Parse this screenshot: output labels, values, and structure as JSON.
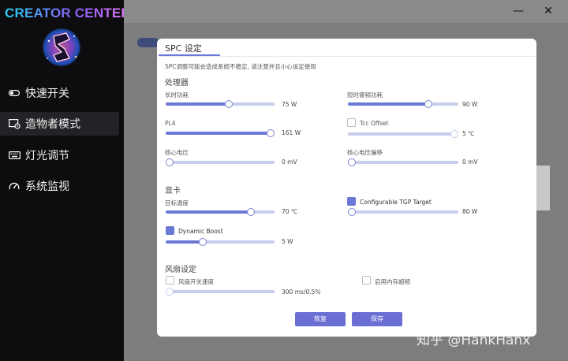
{
  "sidebar": {
    "app_title": "CREATOR CENTER",
    "items": [
      {
        "label": "快速开关",
        "icon": "toggle-icon",
        "active": false
      },
      {
        "label": "造物者模式",
        "icon": "creator-mode-icon",
        "active": true
      },
      {
        "label": "灯光调节",
        "icon": "keyboard-icon",
        "active": false
      },
      {
        "label": "系统监视",
        "icon": "gauge-icon",
        "active": false
      }
    ]
  },
  "window_controls": {
    "minimize": "—",
    "close": "✕"
  },
  "modal": {
    "tab_title": "SPC 设定",
    "warning": "SPC调整可能会造成系统不稳定, 请注意并且小心设定使用",
    "processor": {
      "section_title": "处理器",
      "long_power": {
        "label": "长时功耗",
        "value": "75 W",
        "fraction": 0.58
      },
      "short_power": {
        "label": "短时睿频功耗",
        "value": "90 W",
        "fraction": 0.73
      },
      "pl4": {
        "label": "PL4",
        "value": "161 W",
        "fraction": 0.97
      },
      "tcc_offset": {
        "label": "Tcc Offset",
        "value": "5 ℃",
        "checked": false,
        "fraction": 0.98
      },
      "core_voltage": {
        "label": "核心电压",
        "value": "0 mV",
        "fraction": 0.0
      },
      "core_voltage_offset": {
        "label": "核心电压偏移",
        "value": "0 mV",
        "fraction": 0.0
      }
    },
    "gpu": {
      "section_title": "显卡",
      "target_temp": {
        "label": "目标温度",
        "value": "70 ℃",
        "fraction": 0.78
      },
      "configurable_tgp": {
        "label": "Configurable TGP Target",
        "value": "80 W",
        "checked": true,
        "fraction": 0.0
      },
      "dynamic_boost": {
        "label": "Dynamic Boost",
        "value": "5 W",
        "checked": true,
        "fraction": 0.34
      }
    },
    "fan": {
      "section_title": "风扇设定",
      "fan_switch_speed": {
        "label": "风扇开关速度",
        "value": "300 ms/0.5%",
        "checked": false,
        "fraction": 0.0
      },
      "memory_overclock": {
        "label": "启用内存超频",
        "checked": false
      }
    },
    "buttons": {
      "restore": "恢复",
      "save": "保存"
    }
  },
  "watermark": "知乎 @HankHanx",
  "colors": {
    "accent": "#6b78d6",
    "track": "#c7cdea",
    "sidebar_bg": "#0d0d0f",
    "button": "#6b6fd4"
  }
}
